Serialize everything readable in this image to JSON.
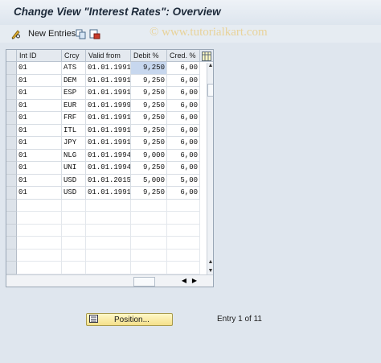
{
  "window": {
    "title": "Change View \"Interest Rates\": Overview"
  },
  "toolbar": {
    "new_entries_label": "New Entries"
  },
  "watermark": "© www.tutorialkart.com",
  "table": {
    "columns": [
      "Int ID",
      "Crcy",
      "Valid from",
      "Debit %",
      "Cred. %"
    ],
    "rows": [
      [
        "01",
        "ATS",
        "01.01.1991",
        "9,250",
        "6,00"
      ],
      [
        "01",
        "DEM",
        "01.01.1991",
        "9,250",
        "6,00"
      ],
      [
        "01",
        "ESP",
        "01.01.1991",
        "9,250",
        "6,00"
      ],
      [
        "01",
        "EUR",
        "01.01.1999",
        "9,250",
        "6,00"
      ],
      [
        "01",
        "FRF",
        "01.01.1991",
        "9,250",
        "6,00"
      ],
      [
        "01",
        "ITL",
        "01.01.1991",
        "9,250",
        "6,00"
      ],
      [
        "01",
        "JPY",
        "01.01.1991",
        "9,250",
        "6,00"
      ],
      [
        "01",
        "NLG",
        "01.01.1994",
        "9,000",
        "6,00"
      ],
      [
        "01",
        "UNI",
        "01.01.1994",
        "9,250",
        "6,00"
      ],
      [
        "01",
        "USD",
        "01.01.2015",
        "5,000",
        "5,00"
      ],
      [
        "01",
        "USD",
        "01.01.1991",
        "9,250",
        "6,00"
      ]
    ],
    "empty_rows": 6,
    "highlighted_cell": "9,250"
  },
  "footer": {
    "position_button_label": "Position...",
    "entry_text": "Entry 1 of 11"
  },
  "colors": {
    "header_bg": "#e4e9ef",
    "button_bg": "#f4e08a",
    "highlight": "#c7d7ee"
  }
}
